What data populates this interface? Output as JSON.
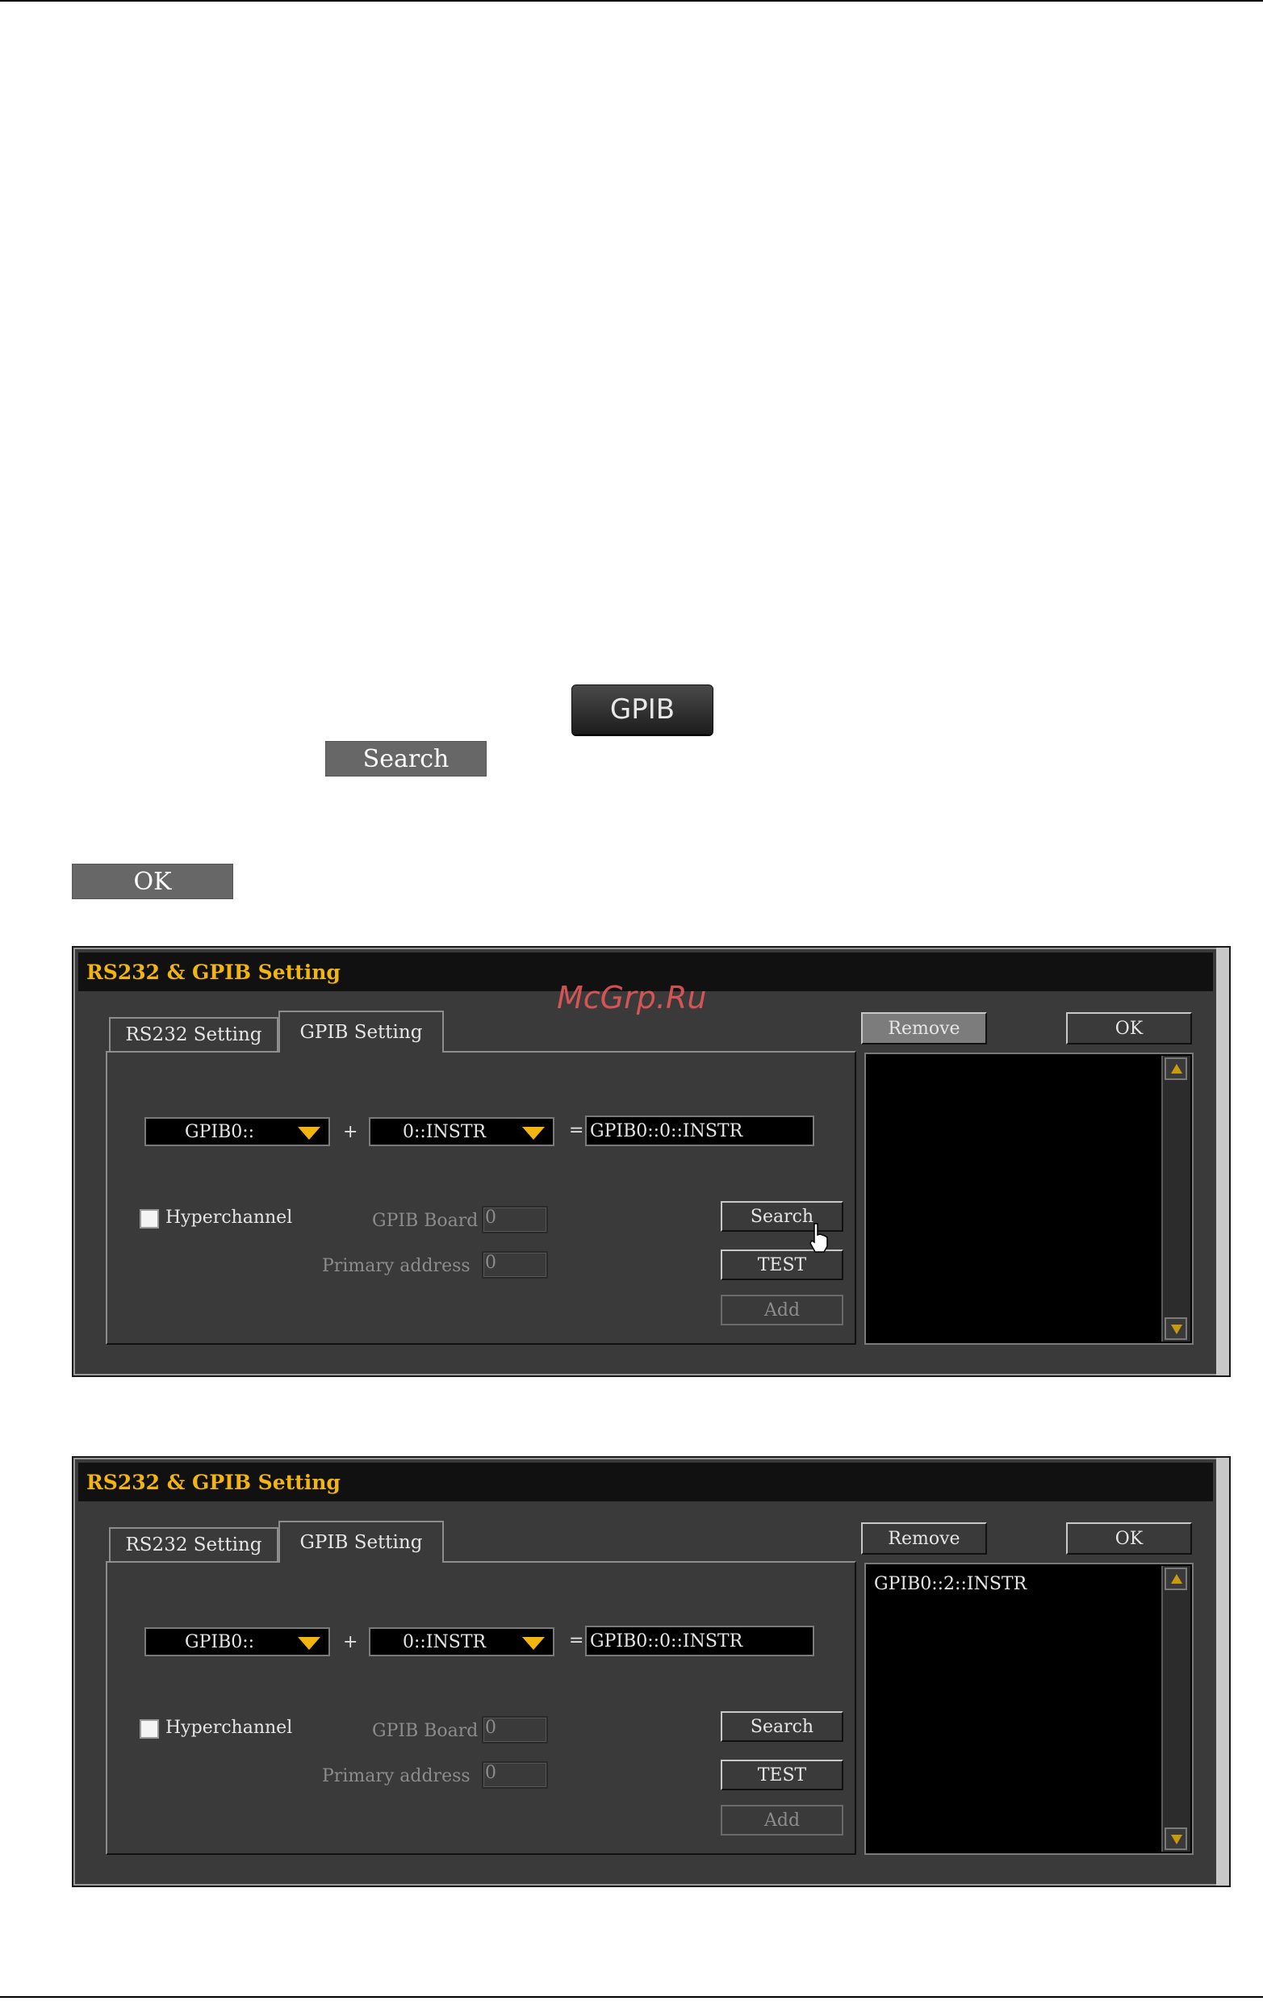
{
  "inline_buttons": {
    "gpib": "GPIB",
    "search": "Search",
    "ok": "OK"
  },
  "watermark": "McGrp.Ru",
  "dialogs": [
    {
      "title": "RS232 & GPIB Setting",
      "tabs": [
        "RS232 Setting",
        "GPIB Setting"
      ],
      "combo_board": "GPIB0::",
      "plus": "+",
      "combo_address": "0::INSTR",
      "equals": "=",
      "result": "GPIB0::0::INSTR",
      "hyperchannel_label": "Hyperchannel",
      "gpib_board_label": "GPIB Board",
      "gpib_board_value": "0",
      "primary_address_label": "Primary address",
      "primary_address_value": "0",
      "search": "Search",
      "test": "TEST",
      "add": "Add",
      "remove": "Remove",
      "ok": "OK",
      "list_item": ""
    },
    {
      "title": "RS232 & GPIB Setting",
      "tabs": [
        "RS232 Setting",
        "GPIB Setting"
      ],
      "combo_board": "GPIB0::",
      "plus": "+",
      "combo_address": "0::INSTR",
      "equals": "=",
      "result": "GPIB0::0::INSTR",
      "hyperchannel_label": "Hyperchannel",
      "gpib_board_label": "GPIB Board",
      "gpib_board_value": "0",
      "primary_address_label": "Primary address",
      "primary_address_value": "0",
      "search": "Search",
      "test": "TEST",
      "add": "Add",
      "remove": "Remove",
      "ok": "OK",
      "list_item": "GPIB0::2::INSTR"
    }
  ],
  "colors": {
    "title_text": "#f2b40f",
    "combo_arrow": "#f2b40f",
    "dialog_bg": "#3a3a3a",
    "watermark": "#f15a5a"
  }
}
